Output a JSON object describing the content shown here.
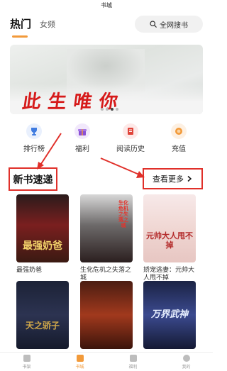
{
  "window": {
    "title": "书城"
  },
  "tabs": [
    {
      "label": "热门",
      "active": true
    },
    {
      "label": "女频",
      "active": false
    }
  ],
  "search": {
    "label": "全网搜书",
    "icon": "search-icon"
  },
  "banner": {
    "text": "此生唯你",
    "dots": 4,
    "active_dot": 2
  },
  "quick_links": [
    {
      "label": "排行榜",
      "icon": "trophy-icon",
      "color": "#3f7be0"
    },
    {
      "label": "福利",
      "icon": "gift-icon",
      "color": "#8a4fd6"
    },
    {
      "label": "阅读历史",
      "icon": "history-icon",
      "color": "#e0443a"
    },
    {
      "label": "充值",
      "icon": "coin-icon",
      "color": "#f29a3a"
    }
  ],
  "section": {
    "title": "新书速递",
    "more_label": "查看更多",
    "more_icon": "chevron-right-icon"
  },
  "books": [
    {
      "title": "最强奶爸",
      "cover_text": "最强奶爸"
    },
    {
      "title": "生化危机之失落之城",
      "cover_text": "生化危机之失落之城"
    },
    {
      "title": "娇宠逃妻：元帅大人甩不掉",
      "cover_text": "元帅大人甩不掉"
    },
    {
      "title": "",
      "cover_text": "天之骄子"
    },
    {
      "title": "",
      "cover_text": ""
    },
    {
      "title": "",
      "cover_text": "万界武神"
    }
  ],
  "bottom_nav": [
    {
      "label": "书架",
      "icon": "bookshelf-icon",
      "active": false
    },
    {
      "label": "书城",
      "icon": "store-icon",
      "active": true
    },
    {
      "label": "福利",
      "icon": "gift-icon",
      "active": false
    },
    {
      "label": "我的",
      "icon": "user-icon",
      "active": false
    }
  ],
  "colors": {
    "accent": "#f29a3a",
    "annotation": "#e0302a"
  }
}
